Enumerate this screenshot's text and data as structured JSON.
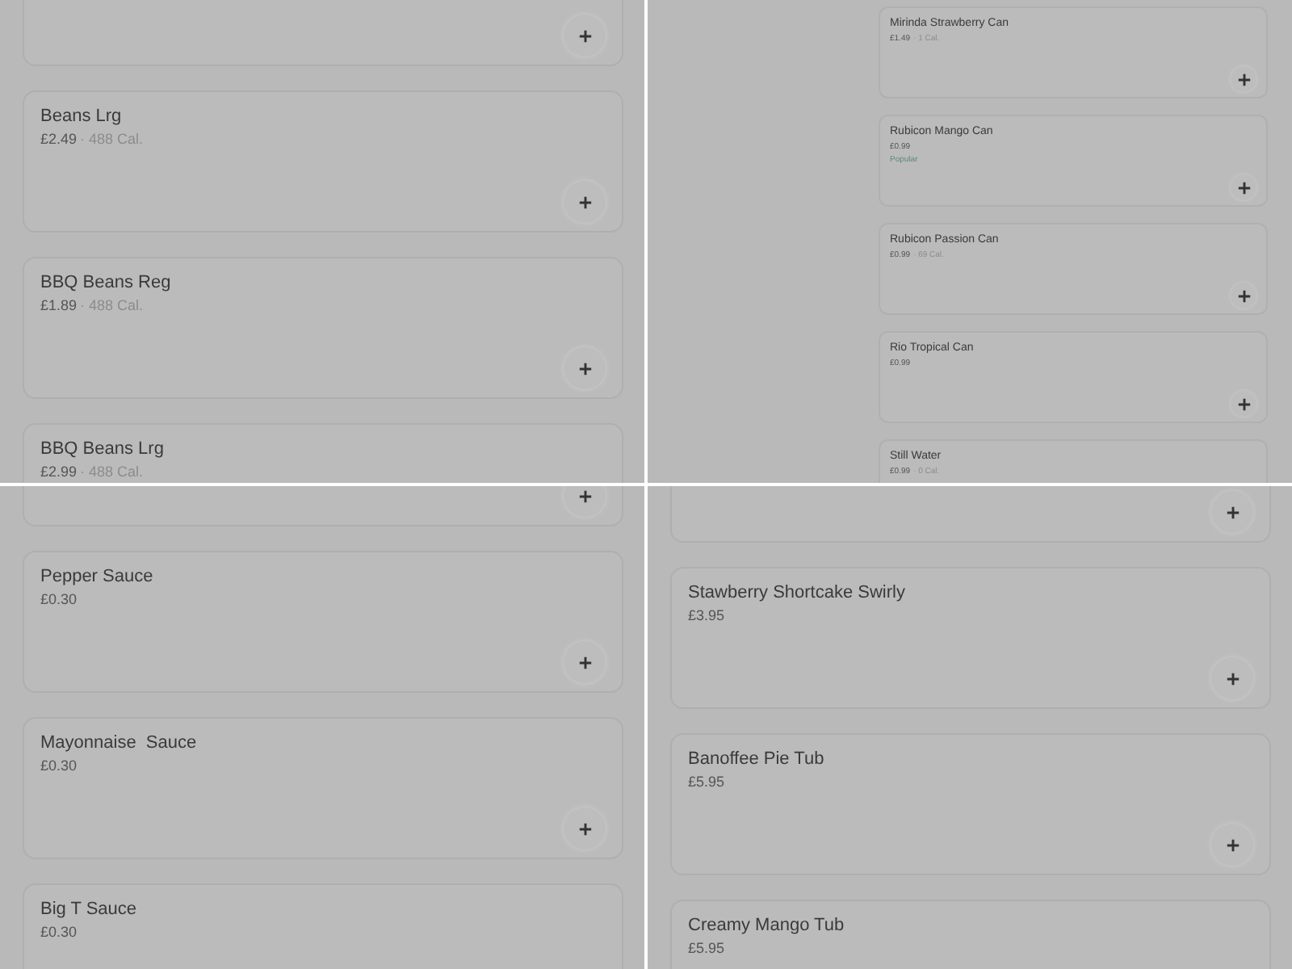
{
  "panels": [
    {
      "kind": "wide",
      "leading_partial_card": true,
      "cards": [
        {
          "title": "Beans Lrg",
          "price": "£2.49",
          "calories": "· 488 Cal."
        },
        {
          "title": "BBQ Beans Reg",
          "price": "£1.89",
          "calories": "· 488 Cal."
        },
        {
          "title": "BBQ Beans Lrg",
          "price": "£2.99",
          "calories": "· 488 Cal."
        }
      ]
    },
    {
      "kind": "narrow",
      "leading_partial_card": false,
      "cards": [
        {
          "title": "Mirinda Strawberry Can",
          "price": "£1.49",
          "calories": "· 1 Cal."
        },
        {
          "title": "Rubicon Mango Can",
          "price": "£0.99",
          "badge": "Popular"
        },
        {
          "title": "Rubicon Passion Can",
          "price": "£0.99",
          "calories": "· 69 Cal."
        },
        {
          "title": "Rio Tropical Can",
          "price": "£0.99"
        },
        {
          "title": "Still Water",
          "price": "£0.99",
          "calories": "· 0 Cal."
        }
      ]
    },
    {
      "kind": "wide",
      "leading_partial_card": true,
      "cards": [
        {
          "title": "Pepper Sauce",
          "price": "£0.30"
        },
        {
          "title": "Mayonnaise  Sauce",
          "price": "£0.30"
        },
        {
          "title": "Big T Sauce",
          "price": "£0.30"
        }
      ]
    },
    {
      "kind": "wide",
      "leading_partial_card": true,
      "cards": [
        {
          "title": "Stawberry Shortcake Swirly",
          "price": "£3.95"
        },
        {
          "title": "Banoffee Pie Tub",
          "price": "£5.95"
        },
        {
          "title": "Creamy Mango Tub",
          "price": "£5.95"
        }
      ]
    }
  ]
}
